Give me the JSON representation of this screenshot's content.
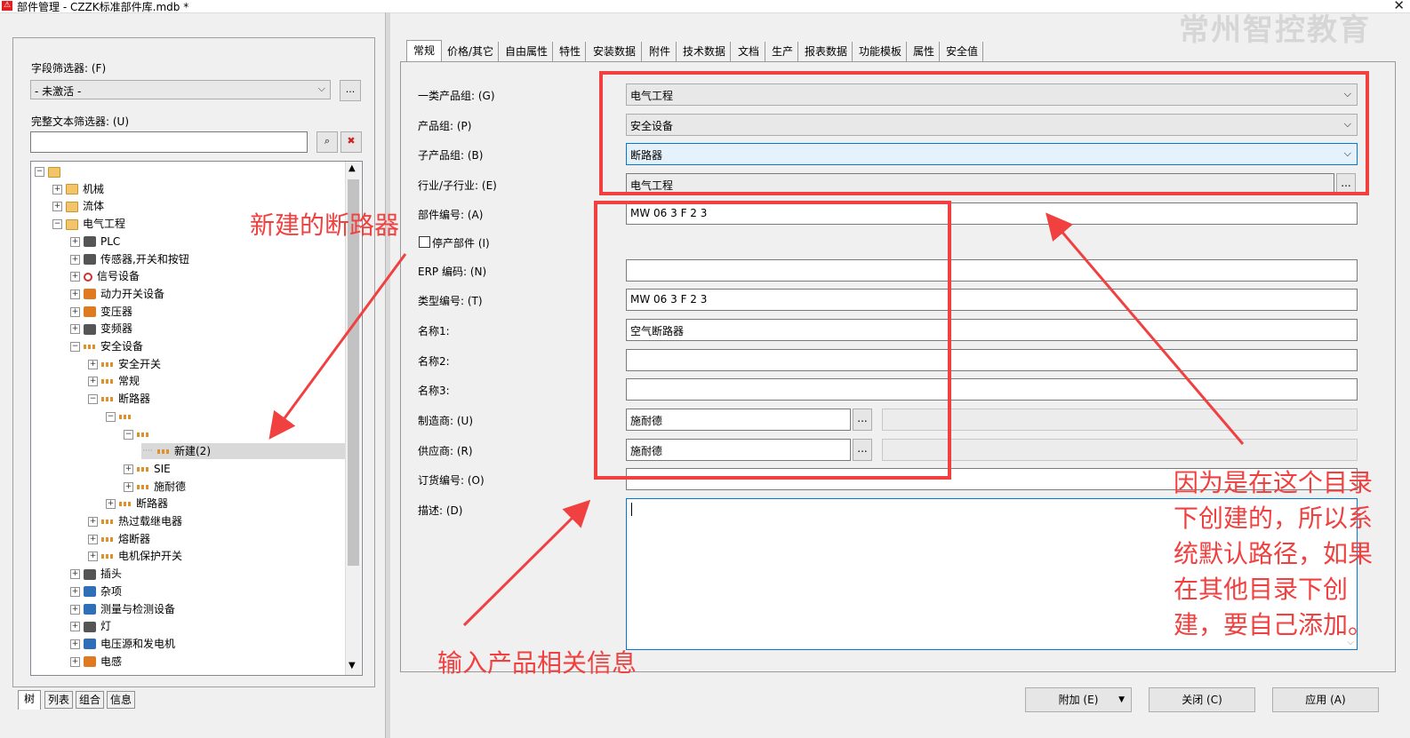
{
  "window": {
    "title": "部件管理 - CZZK标准部件库.mdb *",
    "app_icon": "warning-app-icon",
    "watermark": "常州智控教育"
  },
  "left": {
    "field_filter_label": "字段筛选器: (F)",
    "field_filter_value": "- 未激活 -",
    "field_filter_btn": "...",
    "text_filter_label": "完整文本筛选器: (U)",
    "text_filter_value": "",
    "tree": [
      {
        "label": "",
        "icon": "folder"
      },
      {
        "label": "机械",
        "icon": "folder"
      },
      {
        "label": "流体",
        "icon": "folder"
      },
      {
        "label": "电气工程",
        "icon": "folder"
      },
      {
        "label": "PLC",
        "icon": "gen"
      },
      {
        "label": "传感器,开关和按钮",
        "icon": "gen"
      },
      {
        "label": "信号设备",
        "icon": "red"
      },
      {
        "label": "动力开关设备",
        "icon": "orange"
      },
      {
        "label": "变压器",
        "icon": "orange"
      },
      {
        "label": "变频器",
        "icon": "gen"
      },
      {
        "label": "安全设备",
        "icon": "part"
      },
      {
        "label": "安全开关",
        "icon": "part"
      },
      {
        "label": "常规",
        "icon": "part"
      },
      {
        "label": "断路器",
        "icon": "part"
      },
      {
        "label": "",
        "icon": "part"
      },
      {
        "label": "",
        "icon": "part"
      },
      {
        "label": "新建(2)",
        "icon": "part"
      },
      {
        "label": "SIE",
        "icon": "part"
      },
      {
        "label": "施耐德",
        "icon": "part"
      },
      {
        "label": "断路器",
        "icon": "part"
      },
      {
        "label": "热过载继电器",
        "icon": "part"
      },
      {
        "label": "熔断器",
        "icon": "part"
      },
      {
        "label": "电机保护开关",
        "icon": "part"
      },
      {
        "label": "插头",
        "icon": "gen"
      },
      {
        "label": "杂项",
        "icon": "blue"
      },
      {
        "label": "测量与检测设备",
        "icon": "blue"
      },
      {
        "label": "灯",
        "icon": "gen"
      },
      {
        "label": "电压源和发电机",
        "icon": "blue"
      },
      {
        "label": "电感",
        "icon": "orange"
      }
    ],
    "bottom_tabs": [
      "树",
      "列表",
      "组合",
      "信息"
    ]
  },
  "right": {
    "tabs": [
      "常规",
      "价格/其它",
      "自由属性",
      "特性",
      "安装数据",
      "附件",
      "技术数据",
      "文档",
      "生产",
      "报表数据",
      "功能模板",
      "属性",
      "安全值"
    ],
    "fields": {
      "product_group1_label": "一类产品组: (G)",
      "product_group1_value": "电气工程",
      "product_group_label": "产品组: (P)",
      "product_group_value": "安全设备",
      "sub_group_label": "子产品组: (B)",
      "sub_group_value": "断路器",
      "industry_label": "行业/子行业: (E)",
      "industry_value": "电气工程",
      "part_no_label": "部件编号: (A)",
      "part_no_value": "MW 06 3 F 2 3",
      "discontinued_label": "停产部件 (I)",
      "erp_label": "ERP 编码: (N)",
      "erp_value": "",
      "type_no_label": "类型编号: (T)",
      "type_no_value": "MW 06 3 F 2 3",
      "name1_label": "名称1:",
      "name1_value": "空气断路器",
      "name2_label": "名称2:",
      "name2_value": "",
      "name3_label": "名称3:",
      "name3_value": "",
      "manufacturer_label": "制造商: (U)",
      "manufacturer_value": "施耐德",
      "supplier_label": "供应商: (R)",
      "supplier_value": "施耐德",
      "order_no_label": "订货编号: (O)",
      "order_no_value": "",
      "desc_label": "描述: (D)",
      "desc_value": ""
    },
    "dots_label": "..."
  },
  "buttons": {
    "extra": "附加 (E)",
    "close": "关闭 (C)",
    "apply": "应用 (A)"
  },
  "annotations": {
    "new_breaker": "新建的断路器",
    "input_info": "输入产品相关信息",
    "explain": "因为是在这个目录下创建的，所以系统默认路径，如果在其他目录下创建，要自己添加。",
    "color": "#f04040"
  }
}
